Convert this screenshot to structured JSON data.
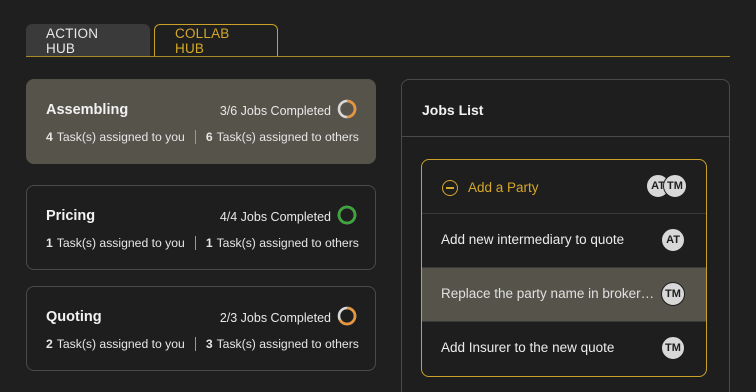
{
  "tabs": [
    {
      "label": "ACTION HUB",
      "active": false
    },
    {
      "label": "COLLAB HUB",
      "active": true
    }
  ],
  "colors": {
    "accent": "#d4a82a",
    "progress_orange": "#e8953a",
    "progress_green": "#3aa63a",
    "selected_bg": "#55534a"
  },
  "stages": [
    {
      "title": "Assembling",
      "jobs_text": "3/6 Jobs Completed",
      "progress": 0.5,
      "ring_color": "#e8953a",
      "mine_count": "4",
      "mine_label": "Task(s) assigned to you",
      "others_count": "6",
      "others_label": "Task(s) assigned to others",
      "selected": true
    },
    {
      "title": "Pricing",
      "jobs_text": "4/4 Jobs Completed",
      "progress": 1.0,
      "ring_color": "#3aa63a",
      "mine_count": "1",
      "mine_label": "Task(s) assigned to you",
      "others_count": "1",
      "others_label": "Task(s) assigned to others",
      "selected": false
    },
    {
      "title": "Quoting",
      "jobs_text": "2/3 Jobs Completed",
      "progress": 0.6667,
      "ring_color": "#e8953a",
      "mine_count": "2",
      "mine_label": "Task(s) assigned to you",
      "others_count": "3",
      "others_label": "Task(s) assigned to others",
      "selected": false
    }
  ],
  "jobs_list": {
    "title": "Jobs List",
    "group": {
      "title": "Add a Party",
      "icon": "minus-circle-icon",
      "avatars": [
        "AT",
        "TM"
      ],
      "jobs": [
        {
          "label": "Add new intermediary to quote",
          "avatar": "AT",
          "highlight": false
        },
        {
          "label": "Replace the party name in broker…",
          "avatar": "TM",
          "highlight": true
        },
        {
          "label": "Add Insurer to the new quote",
          "avatar": "TM",
          "highlight": false
        }
      ]
    }
  }
}
